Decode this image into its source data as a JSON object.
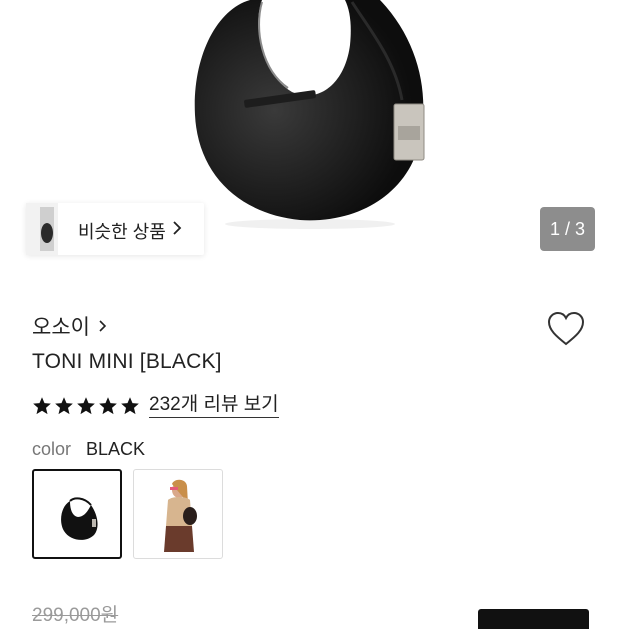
{
  "gallery": {
    "similar_label": "비슷한 상품",
    "pager_text": "1 / 3"
  },
  "product": {
    "brand": "오소이",
    "name": "TONI MINI [BLACK]",
    "rating_stars": 5,
    "review_link": "232개 리뷰 보기",
    "color_label": "color",
    "color_value": "BLACK",
    "original_price": "299,000원"
  },
  "colors": {
    "bag": "#111111",
    "star": "#111111",
    "pager_bg": "#8d8d8d"
  }
}
